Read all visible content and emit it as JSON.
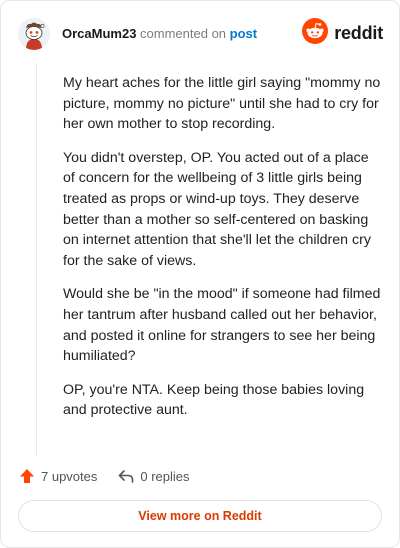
{
  "header": {
    "author": "OrcaMum23",
    "action": "commented on",
    "target": "post",
    "brand": "reddit",
    "avatar_icon": "snoo-avatar-icon",
    "brand_icon": "reddit-snoo-icon"
  },
  "comment": {
    "paragraphs": [
      "My heart aches for the little girl saying \"mommy no picture, mommy no picture\" until she had to cry for her own mother to stop recording.",
      "You didn't overstep, OP. You acted out of a place of concern for the wellbeing of 3 little girls being treated as props or wind-up toys. They deserve better than a mother so self-centered on basking on internet attention that she'll let the children cry for the sake of views.",
      "Would she be \"in the mood\" if someone had filmed her tantrum after husband called out her behavior, and posted it online for strangers to see her being humiliated?",
      "OP, you're NTA. Keep being those babies loving and protective aunt."
    ]
  },
  "footer": {
    "upvotes_label": "7 upvotes",
    "replies_label": "0 replies",
    "view_more_label": "View more on Reddit"
  },
  "colors": {
    "brand": "#ff4500",
    "link": "#0079d3",
    "button_text": "#d93a00"
  }
}
